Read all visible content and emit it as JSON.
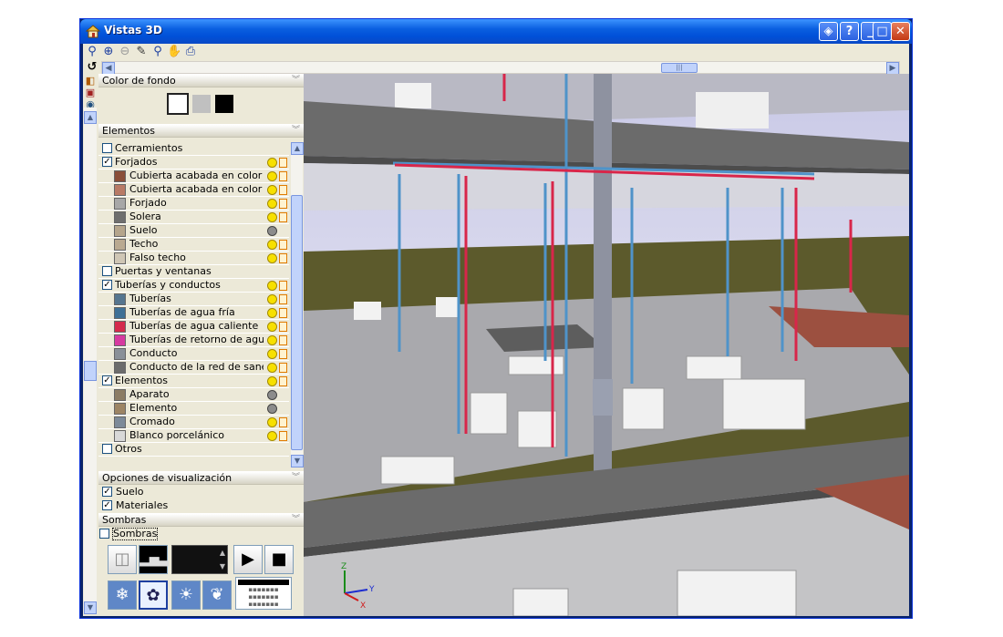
{
  "window": {
    "title": "Vistas 3D"
  },
  "titlebar_buttons": [
    "?",
    "_",
    "□",
    "✕"
  ],
  "toolbar": {
    "icons": [
      "zoom-select-icon",
      "zoom-in-icon",
      "zoom-out-icon",
      "pen-icon",
      "zoom-window-icon",
      "pan-hand-icon",
      "print-icon"
    ]
  },
  "panel": {
    "color_section": {
      "title": "Color de fondo",
      "swatches": [
        "#ffffff",
        "#c0c0c0",
        "#000000"
      ]
    },
    "elements_section": {
      "title": "Elementos",
      "rows": [
        {
          "label": "Cerramientos",
          "level": 0,
          "checked": false
        },
        {
          "label": "Forjados",
          "level": 0,
          "checked": true,
          "bulb": "yellow"
        },
        {
          "label": "Cubierta acabada en color medio",
          "level": 1,
          "color": "#8a4e38",
          "bulb": "yellow"
        },
        {
          "label": "Cubierta acabada en color medio",
          "level": 1,
          "color": "#b87a66",
          "bulb": "yellow"
        },
        {
          "label": "Forjado",
          "level": 1,
          "color": "#a7a7a7",
          "bulb": "yellow"
        },
        {
          "label": "Solera",
          "level": 1,
          "color": "#6e6e6e",
          "bulb": "yellow"
        },
        {
          "label": "Suelo",
          "level": 1,
          "color": "#b5a58c",
          "bulb": "grey"
        },
        {
          "label": "Techo",
          "level": 1,
          "color": "#b9a990",
          "bulb": "yellow"
        },
        {
          "label": "Falso techo",
          "level": 1,
          "color": "#cfc6b5",
          "bulb": "yellow"
        },
        {
          "label": "Puertas y ventanas",
          "level": 0,
          "checked": false
        },
        {
          "label": "Tuberías y conductos",
          "level": 0,
          "checked": true,
          "bulb": "yellow"
        },
        {
          "label": "Tuberías",
          "level": 1,
          "color": "#55758f",
          "bulb": "yellow"
        },
        {
          "label": "Tuberías de agua fría",
          "level": 1,
          "color": "#3f7096",
          "bulb": "yellow"
        },
        {
          "label": "Tuberías de agua caliente",
          "level": 1,
          "color": "#d42a4c",
          "bulb": "yellow"
        },
        {
          "label": "Tuberías de retorno de agua ca...",
          "level": 1,
          "color": "#d63aa0",
          "bulb": "yellow"
        },
        {
          "label": "Conducto",
          "level": 1,
          "color": "#8a9098",
          "bulb": "yellow"
        },
        {
          "label": "Conducto de la red de saneami...",
          "level": 1,
          "color": "#6c6c6c",
          "bulb": "yellow"
        },
        {
          "label": "Elementos",
          "level": 0,
          "checked": true,
          "bulb": "yellow"
        },
        {
          "label": "Aparato",
          "level": 1,
          "color": "#8c7c64",
          "bulb": "grey"
        },
        {
          "label": "Elemento",
          "level": 1,
          "color": "#9c8464",
          "bulb": "grey"
        },
        {
          "label": "Cromado",
          "level": 1,
          "color": "#7d8a99",
          "bulb": "yellow"
        },
        {
          "label": "Blanco porcelánico",
          "level": 1,
          "color": "#d8d8d8",
          "bulb": "yellow"
        },
        {
          "label": "Otros",
          "level": 0,
          "checked": false
        }
      ]
    },
    "visual_section": {
      "title": "Opciones de visualización",
      "options": [
        {
          "label": "Suelo",
          "checked": true
        },
        {
          "label": "Materiales",
          "checked": true
        }
      ]
    },
    "shadows_section": {
      "title": "Sombras",
      "checkbox": {
        "label": "Sombras",
        "checked": false
      },
      "buttons_row1": [
        "box-view-icon",
        "skyline-icon",
        "time-slider",
        "play-icon",
        "stop-icon"
      ],
      "buttons_row2": [
        "snowflake-icon",
        "flower-icon",
        "sun-icon",
        "maple-leaf-icon",
        "calendar-icon"
      ]
    }
  },
  "viewport": {
    "axes": {
      "x": "X",
      "y": "Y",
      "z": "Z"
    },
    "colors": {
      "slab": "#6b6b6b",
      "floor": "#a9a9ad",
      "grass": "#5c5a2c",
      "brick": "#9c5040",
      "sky": "#d6d6ea",
      "cold": "#4f93c9",
      "hot": "#d8264a",
      "fixture": "#f2f2f2"
    }
  }
}
